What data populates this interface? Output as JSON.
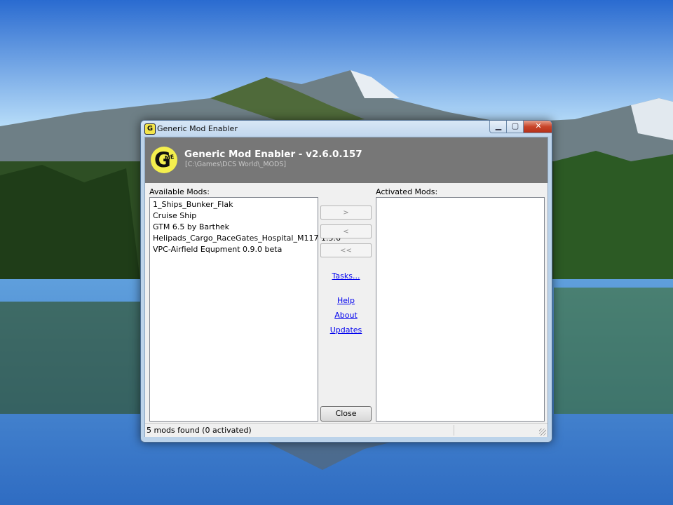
{
  "window": {
    "title": "Generic Mod Enabler",
    "minimize_glyph": "▁",
    "maximize_glyph": "▢",
    "close_glyph": "✕"
  },
  "header": {
    "logo_mark": "G",
    "logo_sub": "ME",
    "heading": "Generic Mod Enabler - v2.6.0.157",
    "path": "[C:\\Games\\DCS World\\_MODS]"
  },
  "available": {
    "label": "Available Mods:",
    "items": [
      "1_Ships_Bunker_Flak",
      "Cruise Ship",
      "GTM 6.5 by Barthek",
      "Helipads_Cargo_RaceGates_Hospital_M117 1.5.6",
      "VPC-Airfield Equpment 0.9.0 beta"
    ]
  },
  "activated": {
    "label": "Activated Mods:",
    "items": []
  },
  "buttons": {
    "activate": ">",
    "deactivate": "<",
    "deactivate_all": "<<",
    "close": "Close"
  },
  "links": {
    "tasks": "Tasks...",
    "help": "Help",
    "about": "About",
    "updates": "Updates"
  },
  "status": {
    "text": "5 mods found (0 activated)"
  },
  "colors": {
    "header_band": "#777777",
    "logo_yellow": "#f4ef4e",
    "link_blue": "#0000ee"
  }
}
